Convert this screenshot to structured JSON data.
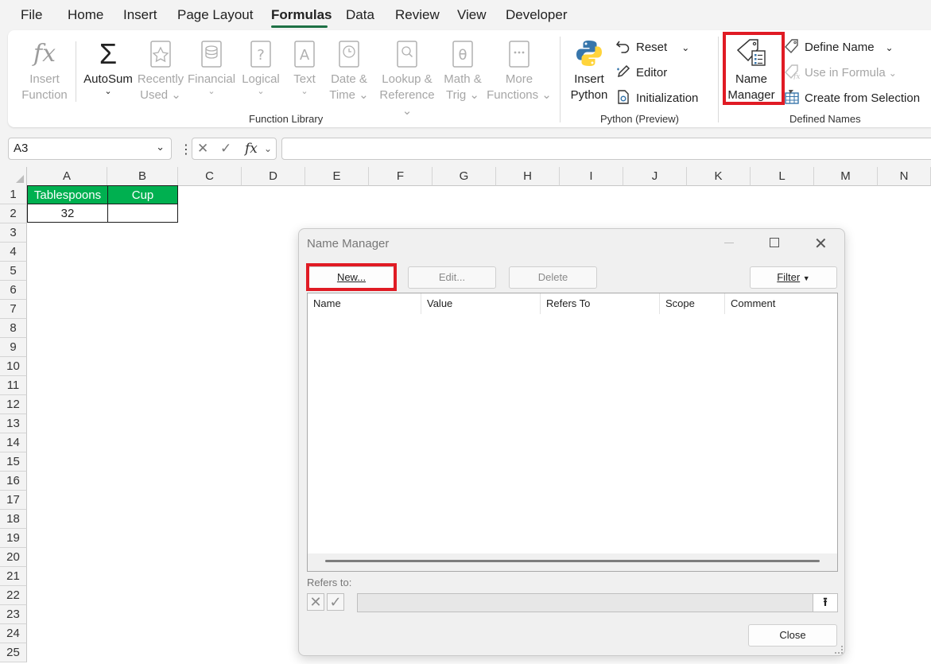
{
  "menu": {
    "tabs": [
      "File",
      "Home",
      "Insert",
      "Page Layout",
      "Formulas",
      "Data",
      "Review",
      "View",
      "Developer"
    ],
    "active": "Formulas"
  },
  "ribbon": {
    "function_library": {
      "label": "Function Library",
      "insert_function": [
        "Insert",
        "Function"
      ],
      "autosum": "AutoSum",
      "recently_used": [
        "Recently",
        "Used"
      ],
      "financial": "Financial",
      "logical": "Logical",
      "text": "Text",
      "date_time": [
        "Date &",
        "Time"
      ],
      "lookup": [
        "Lookup &",
        "Reference"
      ],
      "math": [
        "Math &",
        "Trig"
      ],
      "more": [
        "More",
        "Functions"
      ]
    },
    "python": {
      "label": "Python (Preview)",
      "insert_python": [
        "Insert",
        "Python"
      ],
      "reset": "Reset",
      "editor": "Editor",
      "initialization": "Initialization"
    },
    "defined_names": {
      "label": "Defined Names",
      "name_manager": [
        "Name",
        "Manager"
      ],
      "define_name": "Define Name",
      "use_in_formula": "Use in Formula",
      "create_from_selection": "Create from Selection"
    }
  },
  "formula_bar": {
    "name_box": "A3",
    "formula": ""
  },
  "grid": {
    "columns": [
      "A",
      "B",
      "C",
      "D",
      "E",
      "F",
      "G",
      "H",
      "I",
      "J",
      "K",
      "L",
      "M",
      "N"
    ],
    "rows": [
      "1",
      "2",
      "3",
      "4",
      "5",
      "6",
      "7",
      "8",
      "9",
      "10",
      "11",
      "12",
      "13",
      "14",
      "15",
      "16",
      "17",
      "18",
      "19",
      "20",
      "21",
      "22",
      "23",
      "24",
      "25"
    ],
    "cells": {
      "A1": "Tablespoons",
      "B1": "Cup",
      "A2": "32",
      "B2": ""
    },
    "header_color": "#00b050"
  },
  "dialog": {
    "title": "Name Manager",
    "buttons": {
      "new": "New...",
      "edit": "Edit...",
      "delete": "Delete",
      "filter": "Filter",
      "close": "Close"
    },
    "columns": [
      "Name",
      "Value",
      "Refers To",
      "Scope",
      "Comment"
    ],
    "refers_to_label": "Refers to:",
    "refers_to_value": ""
  },
  "accent_colors": {
    "highlight": "#e01b24",
    "python_blue": "#3776ab",
    "python_yellow": "#ffd43b"
  }
}
